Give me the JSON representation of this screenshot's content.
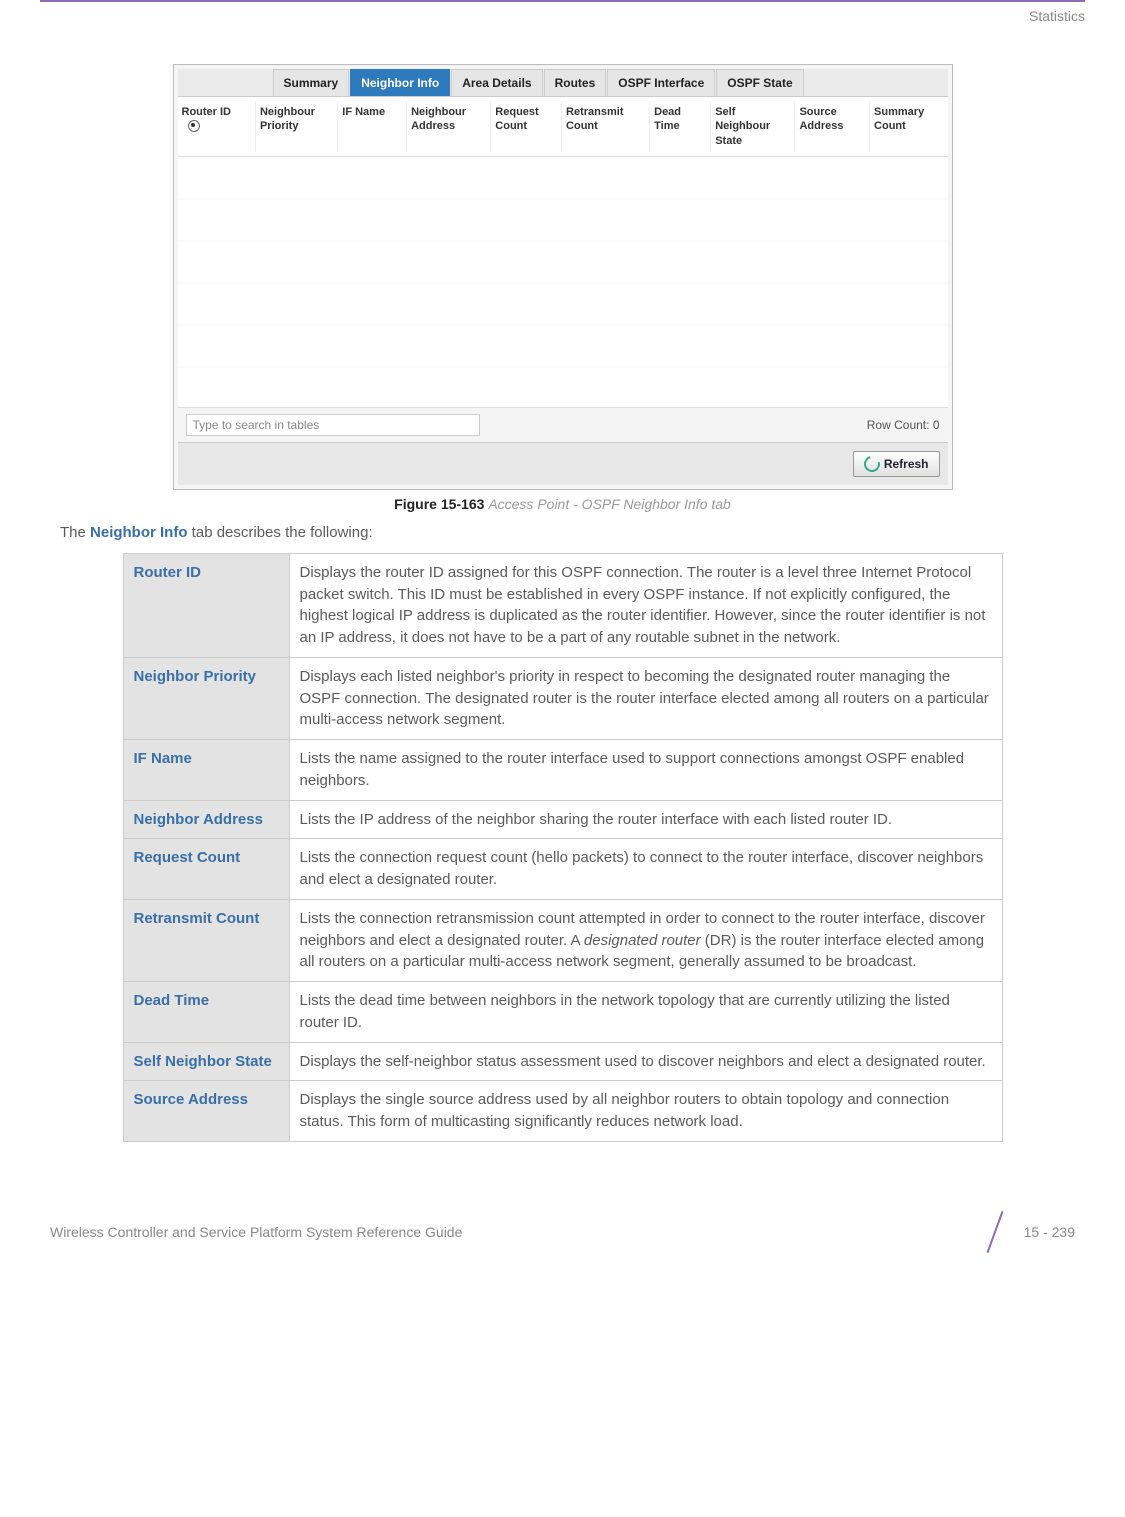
{
  "header": {
    "section_label": "Statistics"
  },
  "screenshot": {
    "tabs": [
      "Summary",
      "Neighbor Info",
      "Area Details",
      "Routes",
      "OSPF Interface",
      "OSPF State"
    ],
    "active_tab_index": 1,
    "columns": [
      "Router ID",
      "Neighbour Priority",
      "IF Name",
      "Neighbour Address",
      "Request Count",
      "Retransmit Count",
      "Dead Time",
      "Self Neighbour State",
      "Source Address",
      "Summary Count"
    ],
    "search_placeholder": "Type to search in tables",
    "row_count_label": "Row Count:",
    "row_count_value": "0",
    "refresh_label": "Refresh"
  },
  "figure": {
    "label": "Figure 15-163",
    "title": "Access Point - OSPF Neighbor Info tab"
  },
  "intro": {
    "prefix": "The ",
    "bold": "Neighbor Info",
    "suffix": " tab describes the following:"
  },
  "rows": [
    {
      "label": "Router ID",
      "desc": "Displays the router ID assigned for this OSPF connection. The router is a level three Internet Protocol packet switch. This ID must be established in every OSPF instance. If not explicitly configured, the highest logical IP address is duplicated as the router identifier. However, since the router identifier is not an IP address, it does not have to be a part of any routable subnet in the network."
    },
    {
      "label": "Neighbor Priority",
      "desc": "Displays each listed neighbor's priority in respect to becoming the designated router managing the OSPF connection. The designated router is the router interface elected among all routers on a particular multi-access network segment."
    },
    {
      "label": "IF Name",
      "desc": "Lists the name assigned to the router interface used to support connections amongst OSPF enabled neighbors."
    },
    {
      "label": "Neighbor Address",
      "desc": "Lists the IP address of the neighbor sharing the router interface with each listed router ID."
    },
    {
      "label": "Request Count",
      "desc": "Lists the connection request count (hello packets) to connect to the router interface, discover neighbors and elect a designated router."
    },
    {
      "label": "Retransmit Count",
      "desc_html": "Lists the connection retransmission count attempted in order to connect to the router interface, discover neighbors and elect a designated router. A <em>designated router</em> (DR) is the router interface elected among all routers on a particular multi-access network segment, generally assumed to be broadcast."
    },
    {
      "label": "Dead Time",
      "desc": "Lists the dead time between neighbors in the network topology that are currently utilizing the listed router ID."
    },
    {
      "label": "Self Neighbor State",
      "desc": "Displays the self-neighbor status assessment used to discover neighbors and elect a designated router."
    },
    {
      "label": "Source Address",
      "desc": "Displays the single source address used by all neighbor routers to obtain topology and connection status. This form of multicasting significantly reduces network load."
    }
  ],
  "footer": {
    "guide_title": "Wireless Controller and Service Platform System Reference Guide",
    "page_number": "15 - 239"
  }
}
